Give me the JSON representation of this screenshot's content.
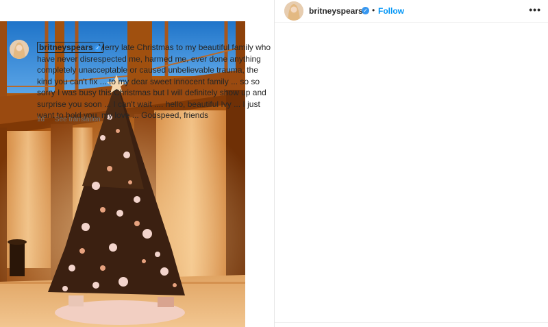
{
  "post": {
    "username": "britneyspears",
    "follow_label": "Follow",
    "separator": "•",
    "more_label": "•••",
    "verified_glyph": "✓"
  },
  "caption": {
    "username": "britneyspears",
    "text": "Merry late Christmas to my beautiful family who have never disrespected me, harmed me, ever done anything completely unacceptable or caused unbelievable trauma, the kind you can't fix ... to my dear sweet innocent family ... so so sorry I was busy this Christmas but I will definitely show up and surprise you soon ...  I can't wait .... hello, beautiful Ivy ... I just want to hold you, my love ... Godspeed, friends",
    "time": "1d",
    "translate_label": "See translation"
  },
  "icons": {
    "verified": "verified-badge-icon",
    "more": "more-options-icon"
  },
  "colors": {
    "link_blue": "#0095f6",
    "verified_blue": "#3797f0",
    "text": "#262626",
    "muted": "#737373"
  }
}
